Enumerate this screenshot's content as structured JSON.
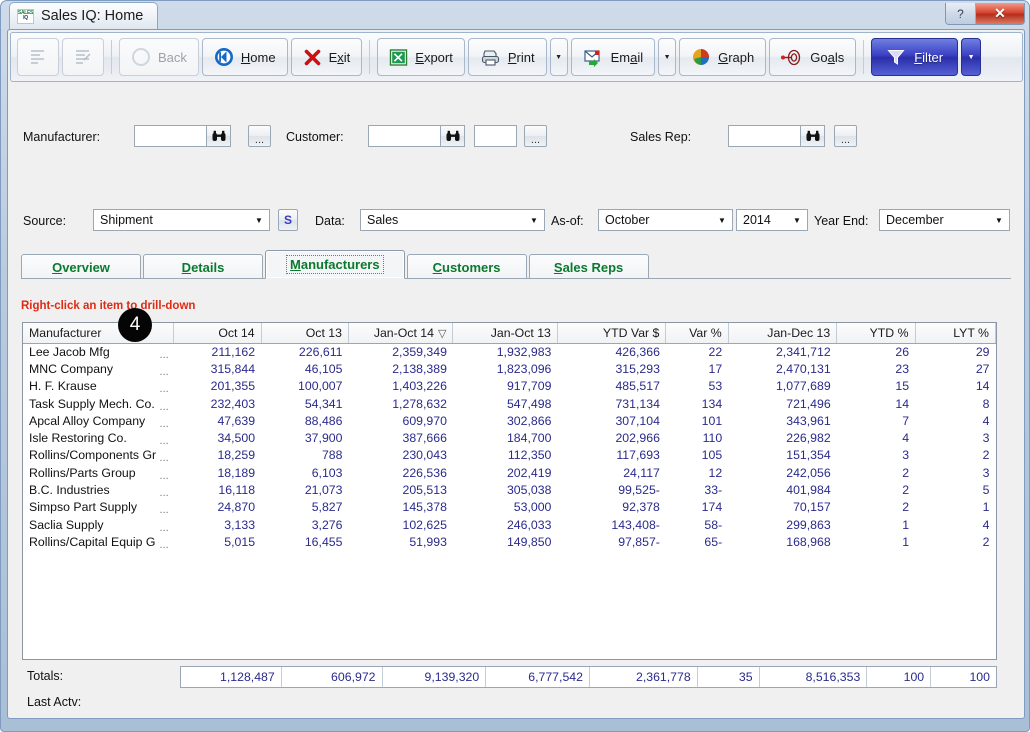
{
  "window": {
    "title": "Sales IQ: Home",
    "logo_top": "SALES",
    "logo_bottom": "IQ",
    "help_button": "?",
    "close_button": "✕"
  },
  "toolbar": {
    "buttons": [
      {
        "name": "outline-collapse",
        "label": "",
        "icon": "outline-icon",
        "state": "disabled"
      },
      {
        "name": "outline-expand",
        "label": "",
        "icon": "outline-edit-icon",
        "state": "disabled"
      },
      {
        "name": "back",
        "label": "Back",
        "accel": "B",
        "icon": "back-arrow-icon",
        "state": "disabled"
      },
      {
        "name": "home",
        "label": "Home",
        "accel": "H",
        "icon": "home-icon",
        "state": "enabled"
      },
      {
        "name": "exit",
        "label": "Exit",
        "accel": "x",
        "icon": "exit-x-icon",
        "state": "enabled"
      },
      {
        "name": "export",
        "label": "Export",
        "accel": "E",
        "icon": "excel-icon",
        "state": "enabled"
      },
      {
        "name": "print",
        "label": "Print",
        "accel": "P",
        "icon": "printer-icon",
        "state": "enabled"
      },
      {
        "name": "email",
        "label": "Email",
        "accel": "a",
        "icon": "email-icon",
        "state": "enabled"
      },
      {
        "name": "graph",
        "label": "Graph",
        "accel": "G",
        "icon": "pie-chart-icon",
        "state": "enabled"
      },
      {
        "name": "goals",
        "label": "Goals",
        "accel": "a",
        "icon": "target-icon",
        "state": "enabled"
      },
      {
        "name": "filter",
        "label": "Filter",
        "accel": "F",
        "icon": "funnel-icon",
        "state": "active"
      }
    ],
    "labels": {
      "back": "Back",
      "home": "Home",
      "exit": "Exit",
      "export": "Export",
      "print": "Print",
      "email": "Email",
      "graph": "Graph",
      "goals": "Goals",
      "filter": "Filter"
    },
    "accent_filter_color": "#3b40c4"
  },
  "criteria": {
    "manufacturer": {
      "label": "Manufacturer:",
      "value": "",
      "placeholder": ""
    },
    "customer": {
      "label": "Customer:",
      "value": "",
      "placeholder": "",
      "extra_value": ""
    },
    "sales_rep": {
      "label": "Sales Rep:",
      "value": "",
      "placeholder": ""
    },
    "source": {
      "label": "Source:",
      "value": "Shipment"
    },
    "s_button": "S",
    "data": {
      "label": "Data:",
      "value": "Sales"
    },
    "as_of": {
      "label": "As-of:",
      "month": "October",
      "year": "2014"
    },
    "year_end": {
      "label": "Year End:",
      "value": "December"
    },
    "ellipsis_label": "..."
  },
  "tabs": [
    {
      "label": "Overview",
      "accel": "O",
      "active": false
    },
    {
      "label": "Details",
      "accel": "D",
      "active": false
    },
    {
      "label": "Manufacturers",
      "accel": "M",
      "active": true
    },
    {
      "label": "Customers",
      "accel": "C",
      "active": false
    },
    {
      "label": "Sales Reps",
      "accel": "S",
      "active": false
    }
  ],
  "hint": "Right-click an item to drill-down",
  "badge": {
    "number": "4"
  },
  "grid": {
    "columns": [
      {
        "key": "manufacturer",
        "label": "Manufacturer",
        "align": "left",
        "sorted": false
      },
      {
        "key": "oct14",
        "label": "Oct 14",
        "align": "right",
        "sorted": false
      },
      {
        "key": "oct13",
        "label": "Oct 13",
        "align": "right",
        "sorted": false
      },
      {
        "key": "janoct14",
        "label": "Jan-Oct 14",
        "align": "right",
        "sorted": true,
        "sort_mark": "▽"
      },
      {
        "key": "janoct13",
        "label": "Jan-Oct 13",
        "align": "right",
        "sorted": false
      },
      {
        "key": "ytdvar",
        "label": "YTD Var $",
        "align": "right",
        "sorted": false
      },
      {
        "key": "varpct",
        "label": "Var %",
        "align": "right",
        "sorted": false
      },
      {
        "key": "jandec13",
        "label": "Jan-Dec 13",
        "align": "right",
        "sorted": false
      },
      {
        "key": "ytdpct",
        "label": "YTD %",
        "align": "right",
        "sorted": false
      },
      {
        "key": "lytpct",
        "label": "LYT %",
        "align": "right",
        "sorted": false
      }
    ],
    "rows": [
      {
        "manufacturer": "Lee Jacob Mfg",
        "oct14": "211,162",
        "oct13": "226,611",
        "janoct14": "2,359,349",
        "janoct13": "1,932,983",
        "ytdvar": "426,366",
        "varpct": "22",
        "jandec13": "2,341,712",
        "ytdpct": "26",
        "lytpct": "29",
        "negative": []
      },
      {
        "manufacturer": "MNC Company",
        "oct14": "315,844",
        "oct13": "46,105",
        "janoct14": "2,138,389",
        "janoct13": "1,823,096",
        "ytdvar": "315,293",
        "varpct": "17",
        "jandec13": "2,470,131",
        "ytdpct": "23",
        "lytpct": "27",
        "negative": []
      },
      {
        "manufacturer": "H. F. Krause",
        "oct14": "201,355",
        "oct13": "100,007",
        "janoct14": "1,403,226",
        "janoct13": "917,709",
        "ytdvar": "485,517",
        "varpct": "53",
        "jandec13": "1,077,689",
        "ytdpct": "15",
        "lytpct": "14",
        "negative": []
      },
      {
        "manufacturer": "Task Supply Mech. Co.",
        "oct14": "232,403",
        "oct13": "54,341",
        "janoct14": "1,278,632",
        "janoct13": "547,498",
        "ytdvar": "731,134",
        "varpct": "134",
        "jandec13": "721,496",
        "ytdpct": "14",
        "lytpct": "8",
        "negative": []
      },
      {
        "manufacturer": "Apcal Alloy Company",
        "oct14": "47,639",
        "oct13": "88,486",
        "janoct14": "609,970",
        "janoct13": "302,866",
        "ytdvar": "307,104",
        "varpct": "101",
        "jandec13": "343,961",
        "ytdpct": "7",
        "lytpct": "4",
        "negative": []
      },
      {
        "manufacturer": "Isle Restoring Co.",
        "oct14": "34,500",
        "oct13": "37,900",
        "janoct14": "387,666",
        "janoct13": "184,700",
        "ytdvar": "202,966",
        "varpct": "110",
        "jandec13": "226,982",
        "ytdpct": "4",
        "lytpct": "3",
        "negative": []
      },
      {
        "manufacturer": "Rollins/Components Gr",
        "oct14": "18,259",
        "oct13": "788",
        "janoct14": "230,043",
        "janoct13": "112,350",
        "ytdvar": "117,693",
        "varpct": "105",
        "jandec13": "151,354",
        "ytdpct": "3",
        "lytpct": "2",
        "negative": []
      },
      {
        "manufacturer": "Rollins/Parts Group",
        "oct14": "18,189",
        "oct13": "6,103",
        "janoct14": "226,536",
        "janoct13": "202,419",
        "ytdvar": "24,117",
        "varpct": "12",
        "jandec13": "242,056",
        "ytdpct": "2",
        "lytpct": "3",
        "negative": []
      },
      {
        "manufacturer": "B.C. Industries",
        "oct14": "16,118",
        "oct13": "21,073",
        "janoct14": "205,513",
        "janoct13": "305,038",
        "ytdvar": "99,525-",
        "varpct": "33-",
        "jandec13": "401,984",
        "ytdpct": "2",
        "lytpct": "5",
        "negative": [
          "ytdvar",
          "varpct"
        ]
      },
      {
        "manufacturer": "Simpso Part Supply",
        "oct14": "24,870",
        "oct13": "5,827",
        "janoct14": "145,378",
        "janoct13": "53,000",
        "ytdvar": "92,378",
        "varpct": "174",
        "jandec13": "70,157",
        "ytdpct": "2",
        "lytpct": "1",
        "negative": []
      },
      {
        "manufacturer": "Saclia Supply",
        "oct14": "3,133",
        "oct13": "3,276",
        "janoct14": "102,625",
        "janoct13": "246,033",
        "ytdvar": "143,408-",
        "varpct": "58-",
        "jandec13": "299,863",
        "ytdpct": "1",
        "lytpct": "4",
        "negative": [
          "ytdvar",
          "varpct"
        ]
      },
      {
        "manufacturer": "Rollins/Capital Equip G",
        "oct14": "5,015",
        "oct13": "16,455",
        "janoct14": "51,993",
        "janoct13": "149,850",
        "ytdvar": "97,857-",
        "varpct": "65-",
        "jandec13": "168,968",
        "ytdpct": "1",
        "lytpct": "2",
        "negative": [
          "ytdvar",
          "varpct"
        ]
      }
    ],
    "row_ellipsis": "..."
  },
  "totals": {
    "label": "Totals:",
    "values": [
      "1,128,487",
      "606,972",
      "9,139,320",
      "6,777,542",
      "2,361,778",
      "35",
      "8,516,353",
      "100",
      "100"
    ]
  },
  "last_activity": {
    "label": "Last Actv:",
    "value": ""
  }
}
